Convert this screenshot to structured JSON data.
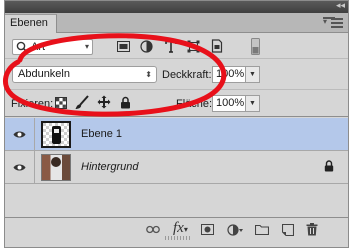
{
  "panel": {
    "tab_label": "Ebenen",
    "collapse_glyph": "◂◂",
    "menu_arrow": "▾"
  },
  "filter": {
    "kind_label": "Art",
    "icons": [
      "pixel-filter-icon",
      "adjustment-filter-icon",
      "type-filter-icon",
      "shape-filter-icon",
      "smart-object-filter-icon",
      "filter-toggle-icon"
    ]
  },
  "blend": {
    "mode": "Abdunkeln",
    "opacity_label": "Deckkraft:",
    "opacity_value": "100%"
  },
  "lock": {
    "label": "Fixieren:",
    "fill_label": "Fläche:",
    "fill_value": "100%",
    "icons": [
      "lock-transparent-icon",
      "lock-image-icon",
      "lock-position-icon",
      "lock-all-icon"
    ]
  },
  "layers": [
    {
      "name": "Ebene 1",
      "visible": true,
      "selected": true,
      "locked": false
    },
    {
      "name": "Hintergrund",
      "visible": true,
      "selected": false,
      "locked": true
    }
  ],
  "footer": {
    "fx_label": "fx",
    "icons": [
      "link-layers-icon",
      "fx-icon",
      "add-mask-icon",
      "adjustment-layer-icon",
      "new-group-icon",
      "new-layer-icon",
      "trash-icon"
    ]
  },
  "colors": {
    "selected_row": "#b4c8ea",
    "annotation": "#e8101a",
    "panel_bg": "#d6d6d6"
  }
}
